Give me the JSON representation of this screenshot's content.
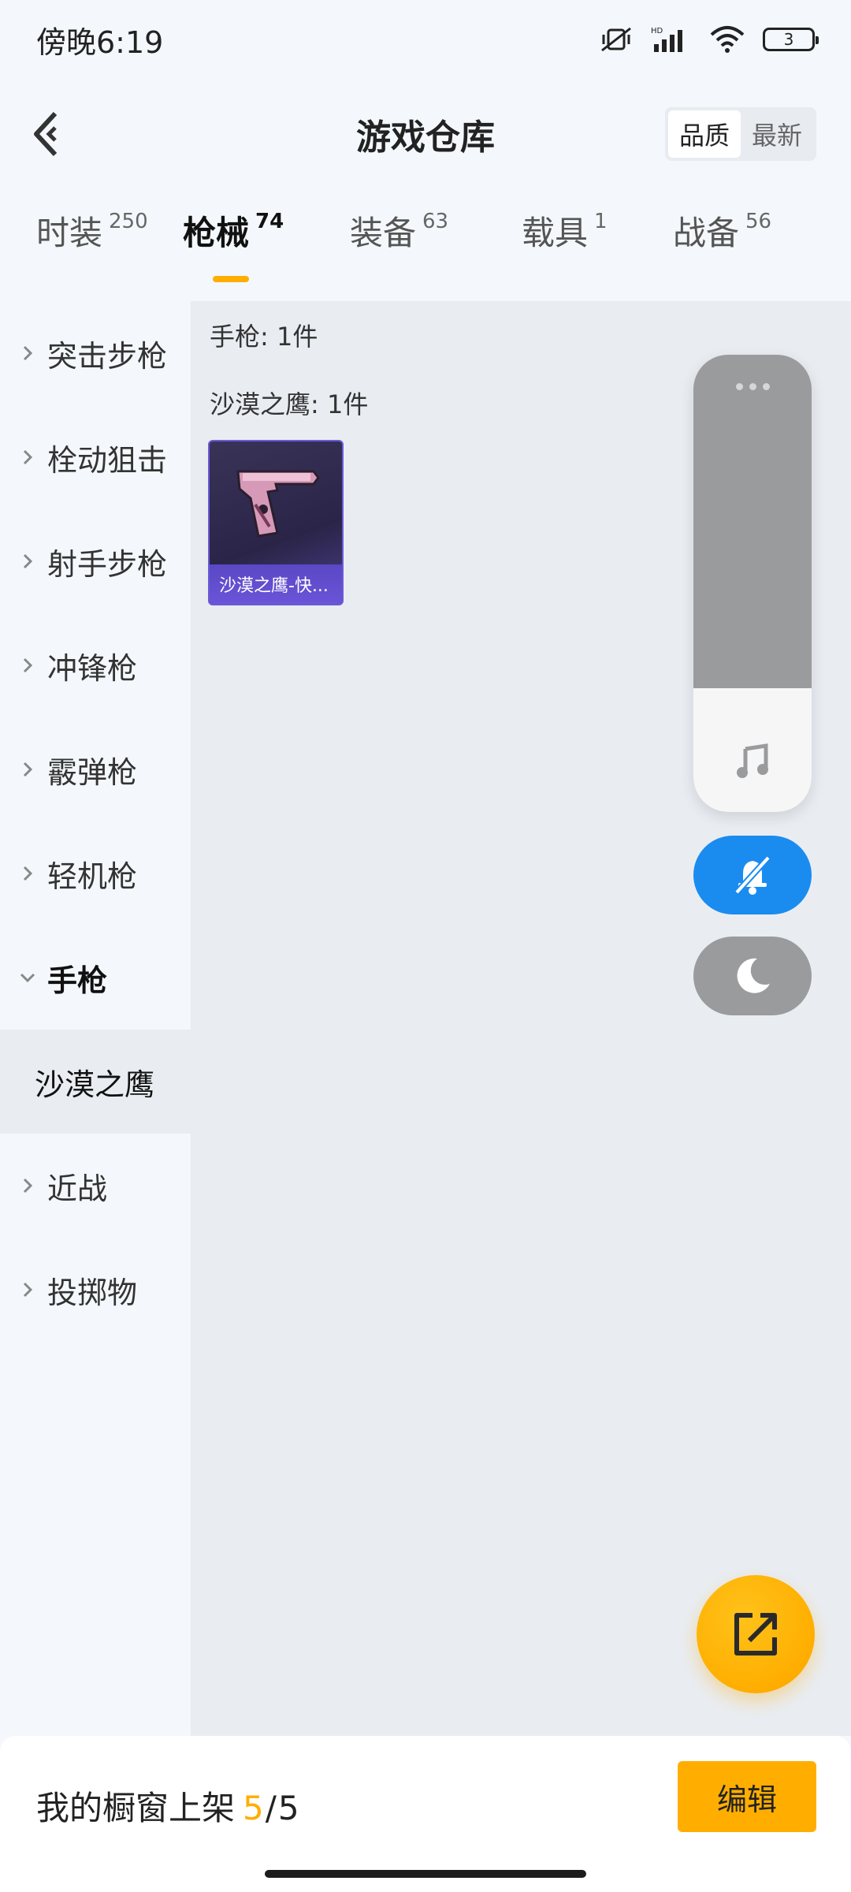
{
  "status_bar": {
    "time": "傍晚6:19",
    "battery": "3",
    "icons": [
      "mute-vibrate-icon",
      "hd-signal-icon",
      "wifi-icon",
      "battery-icon"
    ]
  },
  "header": {
    "title": "游戏仓库",
    "back_icon": "chevron-left-icon",
    "sort_options": [
      "品质",
      "最新"
    ],
    "sort_active": "品质"
  },
  "tabs": [
    {
      "label": "时装",
      "count": "250"
    },
    {
      "label": "枪械",
      "count": "74",
      "active": true
    },
    {
      "label": "装备",
      "count": "63"
    },
    {
      "label": "载具",
      "count": "1"
    },
    {
      "label": "战备",
      "count": "56"
    }
  ],
  "sidebar": {
    "items": [
      {
        "label": "突击步枪"
      },
      {
        "label": "栓动狙击"
      },
      {
        "label": "射手步枪"
      },
      {
        "label": "冲锋枪"
      },
      {
        "label": "霰弹枪"
      },
      {
        "label": "轻机枪"
      },
      {
        "label": "手枪",
        "expanded": true
      },
      {
        "label": "近战"
      },
      {
        "label": "投掷物"
      }
    ],
    "sub_selected": "沙漠之鹰"
  },
  "content": {
    "category_count": "手枪: 1件",
    "subcategory_count": "沙漠之鹰: 1件",
    "items": [
      {
        "name": "沙漠之鹰-快...",
        "rarity_color": "#6a5bd6"
      }
    ]
  },
  "floating_panel": {
    "volume_level": 0.27,
    "icons": [
      "more-dots-icon",
      "music-note-icon",
      "bell-off-icon",
      "moon-icon"
    ]
  },
  "bottom_bar": {
    "label": "我的橱窗上架",
    "used": "5",
    "separator": "/",
    "total": "5",
    "edit_label": "编辑"
  },
  "colors": {
    "accent": "#ffae00",
    "mute_blue": "#1a8cf0",
    "panel_gray": "#9a9b9d"
  }
}
